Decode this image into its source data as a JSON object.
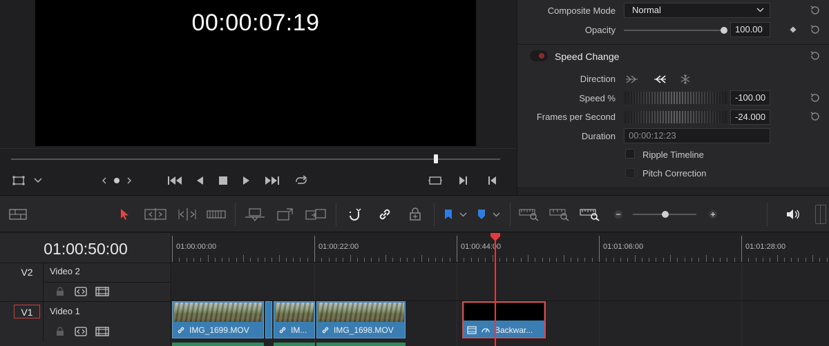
{
  "viewer": {
    "timecode": "00:00:07:19",
    "scrub_position": 0.868
  },
  "inspector": {
    "composite_mode_label": "Composite Mode",
    "composite_mode_value": "Normal",
    "opacity_label": "Opacity",
    "opacity_value": "100.00",
    "speed_change_title": "Speed Change",
    "direction_label": "Direction",
    "speed_label": "Speed %",
    "speed_value": "-100.00",
    "fps_label": "Frames per Second",
    "fps_value": "-24.000",
    "duration_label": "Duration",
    "duration_value": "00:00:12:23",
    "ripple_label": "Ripple Timeline",
    "pitch_label": "Pitch Correction"
  },
  "timeline": {
    "current_timecode": "01:00:50:00",
    "ruler_labels": [
      "01:00:00:00",
      "01:00:22:00",
      "01:00:44:00",
      "01:01:06:00",
      "01:01:28:00"
    ],
    "tracks": [
      {
        "id": "V2",
        "name": "Video 2"
      },
      {
        "id": "V1",
        "name": "Video 1"
      }
    ],
    "clips": [
      {
        "label": "IMG_1699.MOV",
        "selected": false
      },
      {
        "label": "",
        "selected": false
      },
      {
        "label": "IM...",
        "selected": false
      },
      {
        "label": "IMG_1698.MOV",
        "selected": false
      },
      {
        "label": "Backwar...",
        "selected": true
      }
    ],
    "zoom_level": 0.5
  },
  "colors": {
    "playhead": "#e23b3b",
    "clip_blue": "#3a7db3",
    "selection_red": "#e04848",
    "audio_green": "#2f8a5e",
    "accent_blue": "#2f7de1"
  },
  "icons": {
    "toolbar": [
      "timeline-view-icon",
      "selection-arrow-icon",
      "trim-edit-icon",
      "dynamic-trim-icon",
      "blade-icon",
      "insert-clip-icon",
      "overwrite-clip-icon",
      "replace-clip-icon",
      "snapping-icon",
      "linked-selection-icon",
      "position-lock-icon",
      "flag-icon",
      "marker-icon",
      "zoom-full-icon",
      "zoom-detail-icon",
      "zoom-custom-icon",
      "zoom-out-icon",
      "zoom-in-icon",
      "audio-volume-icon"
    ]
  }
}
